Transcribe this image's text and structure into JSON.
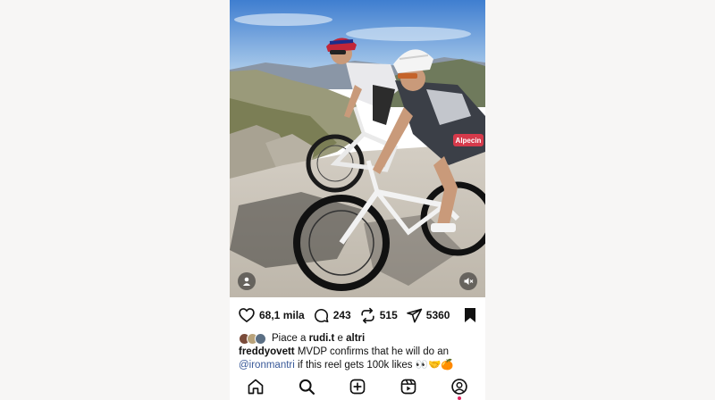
{
  "post": {
    "username": "freddyovett",
    "caption_text": " MVDP confirms that he will do an ",
    "mention": "@ironmantri",
    "caption_tail": " if this reel gets 100k likes 👀🤝🍊",
    "liked_by_prefix": "Piace a ",
    "liked_by_user": "rudi.t",
    "liked_by_suffix": " e ",
    "liked_by_others": "altri"
  },
  "stats": {
    "likes": "68,1 mila",
    "comments": "243",
    "reposts": "515",
    "shares": "5360"
  },
  "media": {
    "jersey_text": "Alpecin",
    "scene": "two cyclists riding on a mountain road"
  },
  "colors": {
    "sky_top": "#3f7ed0",
    "sky_bottom": "#b9d5ee",
    "road": "#c8c2b8",
    "mention": "#385898",
    "notification_dot": "#e0245e"
  },
  "icons": [
    "heart-icon",
    "comment-icon",
    "repost-icon",
    "send-icon",
    "bookmark-icon",
    "home-icon",
    "search-icon",
    "create-icon",
    "reels-icon",
    "profile-icon",
    "tag-people-icon",
    "mute-icon"
  ]
}
